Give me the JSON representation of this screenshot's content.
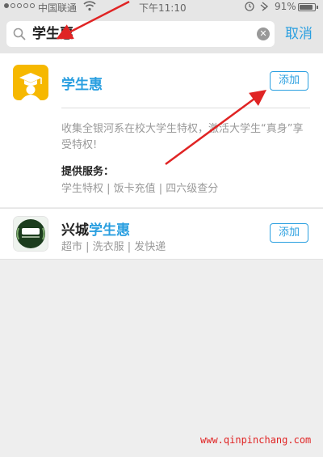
{
  "status_bar": {
    "carrier": "中国联通",
    "time": "下午11:10",
    "battery": "91%",
    "battery_level": 0.91
  },
  "search": {
    "query": "学生惠",
    "cancel_label": "取消"
  },
  "results": [
    {
      "name": "学生惠",
      "add_label": "添加",
      "description": "收集全银河系在校大学生特权，激活大学生“真身”享受特权!",
      "services_title": "提供服务：",
      "services": "学生特权 | 饭卡充值 | 四六级查分"
    },
    {
      "name_prefix": "兴城",
      "name_highlight": "学生惠",
      "add_label": "添加",
      "tags": "超市 | 洗衣服 | 发快递"
    }
  ],
  "watermark": "www.qinpinchang.com",
  "colors": {
    "accent": "#2a9fe0",
    "annotation": "#e02424",
    "app_icon": "#f6b800"
  }
}
